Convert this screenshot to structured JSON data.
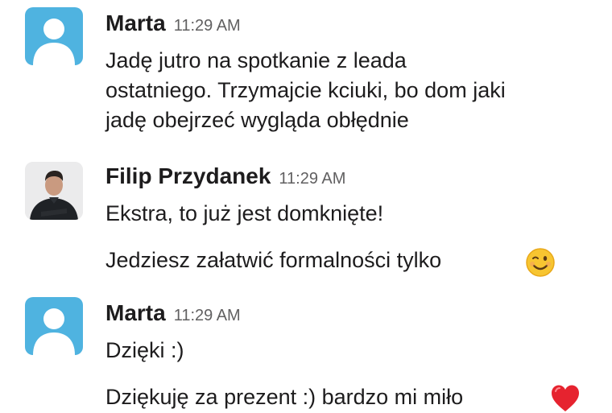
{
  "messages": [
    {
      "author": "Marta",
      "time": "11:29 AM",
      "lines": [
        "Jadę jutro na spotkanie z leada",
        "ostatniego. Trzymajcie kciuki, bo dom jaki",
        "jadę obejrzeć wygląda obłędnie"
      ]
    },
    {
      "author": "Filip Przydanek",
      "time": "11:29 AM",
      "lines": [
        "Ekstra, to już jest domknięte!",
        "Jedziesz załatwić formalności tylko"
      ],
      "emoji": "winking-face"
    },
    {
      "author": "Marta",
      "time": "11:29 AM",
      "lines": [
        "Dzięki :)",
        "Dziękuję za prezent :) bardzo mi miło"
      ],
      "emoji": "red-heart"
    }
  ],
  "colors": {
    "avatar_default": "#4fb3e0",
    "text": "#1d1c1d",
    "timestamp": "#616061"
  }
}
